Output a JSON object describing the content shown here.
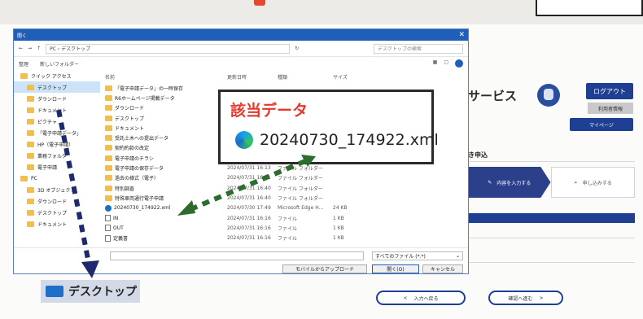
{
  "background_page": {
    "service_title": "サービス",
    "logout_label": "ログアウト",
    "account_label": "利用者情報",
    "mypage_label": "マイページ",
    "section_title": "き申込",
    "steps": [
      {
        "label": "内容を入力する",
        "icon": "pencil-icon"
      },
      {
        "label": "申し込みする",
        "icon": "send-icon"
      }
    ],
    "back_label": "入力へ戻る",
    "next_label": "確認へ進む"
  },
  "dialog": {
    "title": "開く",
    "address_path": "PC › デスクトップ",
    "search_placeholder": "デスクトップの検索",
    "toolbar": {
      "organize": "整理",
      "new_folder": "新しいフォルダー"
    },
    "nav_items": [
      {
        "label": "クイック アクセス",
        "level": 0
      },
      {
        "label": "デスクトップ",
        "level": 1,
        "selected": true
      },
      {
        "label": "ダウンロード",
        "level": 1
      },
      {
        "label": "ドキュメント",
        "level": 1
      },
      {
        "label": "ピクチャ",
        "level": 1
      },
      {
        "label": "「電子申請データ」",
        "level": 1
      },
      {
        "label": "HP（電子申請）",
        "level": 1
      },
      {
        "label": "業務フォルダ",
        "level": 1
      },
      {
        "label": "電子申請",
        "level": 1
      },
      {
        "label": "PC",
        "level": 0
      },
      {
        "label": "3D オブジェクト",
        "level": 1
      },
      {
        "label": "ダウンロード",
        "level": 1
      },
      {
        "label": "デスクトップ",
        "level": 1
      },
      {
        "label": "ドキュメント",
        "level": 1
      }
    ],
    "columns": {
      "name": "名前",
      "date": "更新日時",
      "type": "種類",
      "size": "サイズ"
    },
    "files": [
      {
        "name": "「電子申請データ」の一時保存",
        "date": "",
        "type": "",
        "size": "",
        "kind": "folder"
      },
      {
        "name": "R6ホームページ掲載データ",
        "date": "",
        "type": "",
        "size": "",
        "kind": "folder"
      },
      {
        "name": "ダウンロード",
        "date": "",
        "type": "",
        "size": "",
        "kind": "folder"
      },
      {
        "name": "デスクトップ",
        "date": "",
        "type": "",
        "size": "",
        "kind": "folder"
      },
      {
        "name": "ドキュメント",
        "date": "",
        "type": "",
        "size": "",
        "kind": "folder"
      },
      {
        "name": "受託土木への提出データ",
        "date": "",
        "type": "",
        "size": "",
        "kind": "folder"
      },
      {
        "name": "契約約款の改定",
        "date": "",
        "type": "",
        "size": "",
        "kind": "folder"
      },
      {
        "name": "電子申請のチラシ",
        "date": "",
        "type": "",
        "size": "",
        "kind": "folder"
      },
      {
        "name": "電子申請の保存データ",
        "date": "2024/07/31 16:13",
        "type": "ファイル フォルダー",
        "size": "",
        "kind": "folder"
      },
      {
        "name": "過去の様式（電子）",
        "date": "2024/07/31 16:31",
        "type": "ファイル フォルダー",
        "size": "",
        "kind": "folder"
      },
      {
        "name": "特別調査",
        "date": "2024/07/31 16:40",
        "type": "ファイル フォルダー",
        "size": "",
        "kind": "folder"
      },
      {
        "name": "特殊車両通行電子申請",
        "date": "2024/07/31 16:40",
        "type": "ファイル フォルダー",
        "size": "",
        "kind": "folder"
      },
      {
        "name": "20240730_174922.xml",
        "date": "2024/07/30 17:49",
        "type": "Microsoft Edge H...",
        "size": "24 KB",
        "kind": "edge"
      },
      {
        "name": "IN",
        "date": "2024/07/31 16:16",
        "type": "ファイル",
        "size": "1 KB",
        "kind": "file"
      },
      {
        "name": "OUT",
        "date": "2024/07/31 16:16",
        "type": "ファイル",
        "size": "1 KB",
        "kind": "file"
      },
      {
        "name": "定義書",
        "date": "2024/07/31 16:16",
        "type": "ファイル",
        "size": "1 KB",
        "kind": "file"
      }
    ],
    "filename_label": "ファイル名(N):",
    "filetype_value": "すべてのファイル (*.*)",
    "upload_label": "モバイルからアップロード",
    "open_label": "開く(O)",
    "cancel_label": "キャンセル"
  },
  "callout": {
    "title": "該当データ",
    "filename": "20240730_174922.xml"
  },
  "desktop_label": "デスクトップ",
  "colors": {
    "accent_red": "#e3382b",
    "arrow_green": "#2e6b2e",
    "arrow_navy": "#1f2a6e",
    "brand_blue": "#1f3f93"
  }
}
